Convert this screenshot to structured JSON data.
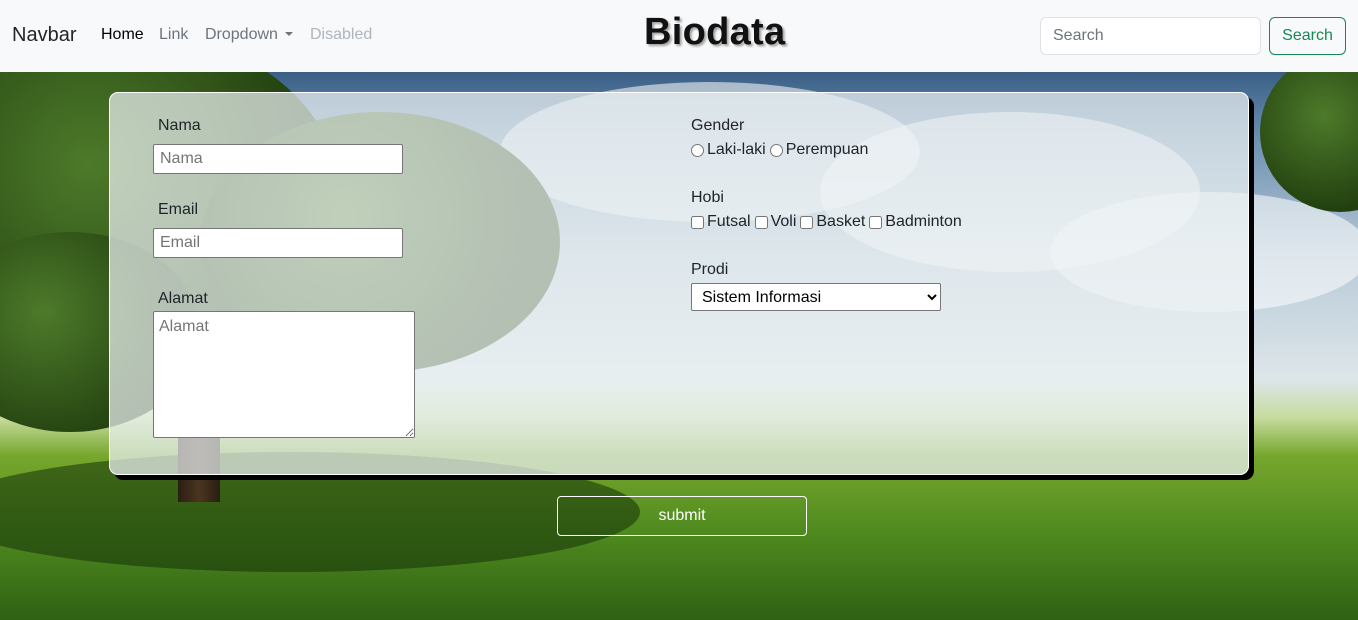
{
  "navbar": {
    "brand": "Navbar",
    "links": [
      "Home",
      "Link",
      "Dropdown",
      "Disabled"
    ],
    "search_placeholder": "Search",
    "search_button": "Search"
  },
  "page_title": "Biodata",
  "form": {
    "nama": {
      "label": "Nama",
      "placeholder": "Nama"
    },
    "email": {
      "label": "Email",
      "placeholder": "Email"
    },
    "alamat": {
      "label": "Alamat",
      "placeholder": "Alamat"
    },
    "gender": {
      "label": "Gender",
      "options": [
        "Laki-laki",
        "Perempuan"
      ]
    },
    "hobi": {
      "label": "Hobi",
      "options": [
        "Futsal",
        "Voli",
        "Basket",
        "Badminton"
      ]
    },
    "prodi": {
      "label": "Prodi",
      "selected": "Sistem Informasi"
    },
    "submit_label": "submit"
  },
  "colors": {
    "navbar_bg": "#f8f9fa",
    "search_button": "#198754"
  }
}
